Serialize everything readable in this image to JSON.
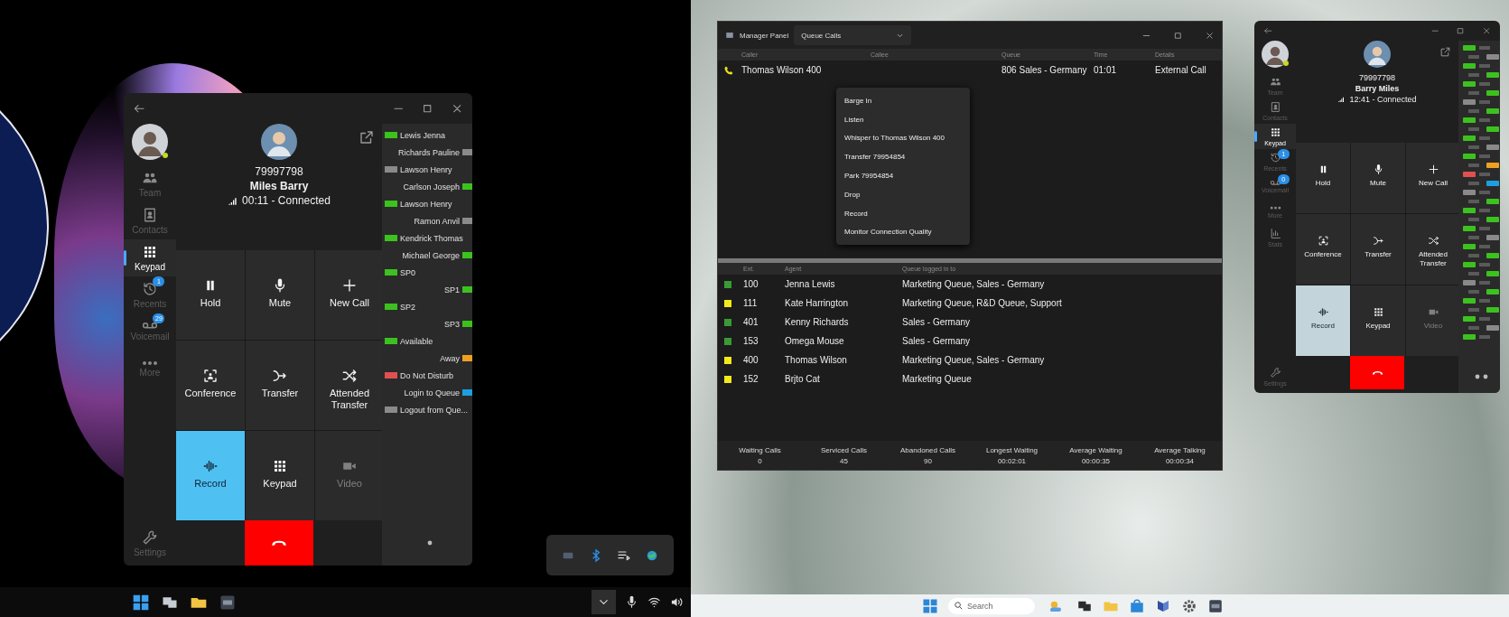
{
  "left_screen": {
    "phone": {
      "sidebar": [
        {
          "label": "Team",
          "selected": false
        },
        {
          "label": "Contacts",
          "selected": false
        },
        {
          "label": "Keypad",
          "selected": true
        },
        {
          "label": "Recents",
          "selected": false,
          "badge": "1"
        },
        {
          "label": "Voicemail",
          "selected": false,
          "badge": "29"
        },
        {
          "label": "More",
          "selected": false
        },
        {
          "label": "Settings",
          "selected": false
        }
      ],
      "caller": {
        "number": "79997798",
        "name": "Miles Barry",
        "status": "00:11 - Connected"
      },
      "actions": [
        {
          "label": "Hold",
          "on": false,
          "disabled": false
        },
        {
          "label": "Mute",
          "on": false,
          "disabled": false
        },
        {
          "label": "New Call",
          "on": false,
          "disabled": false
        },
        {
          "label": "Conference",
          "on": false,
          "disabled": false
        },
        {
          "label": "Transfer",
          "on": false,
          "disabled": false
        },
        {
          "label": "Attended Transfer",
          "on": false,
          "disabled": false
        },
        {
          "label": "Record",
          "on": true,
          "disabled": false
        },
        {
          "label": "Keypad",
          "on": false,
          "disabled": false
        },
        {
          "label": "Video",
          "on": false,
          "disabled": true
        }
      ],
      "presence": [
        {
          "label": "Lewis Jenna",
          "color": "#3cc21f"
        },
        {
          "label": "Richards Pauline",
          "color": "#8a8a8a"
        },
        {
          "label": "Lawson Henry",
          "color": "#8a8a8a"
        },
        {
          "label": "Carlson Joseph",
          "color": "#3cc21f"
        },
        {
          "label": "Lawson Henry",
          "color": "#3cc21f"
        },
        {
          "label": "Ramon Anvil",
          "color": "#8a8a8a"
        },
        {
          "label": "Kendrick Thomas",
          "color": "#3cc21f"
        },
        {
          "label": "Michael George",
          "color": "#3cc21f"
        },
        {
          "label": "SP0",
          "color": "#3cc21f"
        },
        {
          "label": "SP1",
          "color": "#3cc21f"
        },
        {
          "label": "SP2",
          "color": "#3cc21f"
        },
        {
          "label": "SP3",
          "color": "#3cc21f"
        },
        {
          "label": "Available",
          "color": "#3cc21f"
        },
        {
          "label": "Away",
          "color": "#f0a020"
        },
        {
          "label": "Do Not Disturb",
          "color": "#e05050"
        },
        {
          "label": "Login to Queue",
          "color": "#1e9ee0"
        },
        {
          "label": "Logout from Que...",
          "color": "#8a8a8a"
        }
      ]
    }
  },
  "right_screen": {
    "manager_panel": {
      "title": "Manager Panel",
      "view": "Queue Calls",
      "calls_table": {
        "columns": [
          "Caller",
          "Callee",
          "Queue",
          "Time",
          "Details"
        ],
        "rows": [
          {
            "caller": "Thomas Wilson 400",
            "queue": "806 Sales - Germany",
            "time": "01:01",
            "details": "External Call"
          }
        ]
      },
      "context_menu": [
        "Barge In",
        "Listen",
        "Whisper to Thomas Wilson 400",
        "Transfer 79954854",
        "Park 79954854",
        "Drop",
        "Record",
        "Monitor Connection Quality"
      ],
      "agents_table": {
        "columns": [
          "Ext.",
          "Agent",
          "Queue logged in to"
        ],
        "rows": [
          {
            "color": "#3a9a36",
            "ext": "100",
            "agent": "Jenna Lewis",
            "queues": "Marketing Queue, Sales - Germany"
          },
          {
            "color": "#f2ea1c",
            "ext": "111",
            "agent": "Kate Harrington",
            "queues": "Marketing Queue, R&D Queue, Support"
          },
          {
            "color": "#3a9a36",
            "ext": "401",
            "agent": "Kenny Richards",
            "queues": "Sales - Germany"
          },
          {
            "color": "#3a9a36",
            "ext": "153",
            "agent": "Omega Mouse",
            "queues": "Sales - Germany"
          },
          {
            "color": "#f2ea1c",
            "ext": "400",
            "agent": "Thomas Wilson",
            "queues": "Marketing Queue, Sales - Germany"
          },
          {
            "color": "#f2ea1c",
            "ext": "152",
            "agent": "Brjto Cat",
            "queues": "Marketing Queue"
          }
        ]
      },
      "stats": [
        {
          "label": "Waiting Calls",
          "value": "0"
        },
        {
          "label": "Serviced Calls",
          "value": "45"
        },
        {
          "label": "Abandoned Calls",
          "value": "90"
        },
        {
          "label": "Longest Waiting",
          "value": "00:02:01"
        },
        {
          "label": "Average Waiting",
          "value": "00:00:35"
        },
        {
          "label": "Average Talking",
          "value": "00:00:34"
        }
      ]
    },
    "phone": {
      "sidebar": [
        {
          "label": "Team",
          "selected": false
        },
        {
          "label": "Contacts",
          "selected": false
        },
        {
          "label": "Keypad",
          "selected": true
        },
        {
          "label": "Recents",
          "selected": false,
          "badge": "1"
        },
        {
          "label": "Voicemail",
          "selected": false,
          "badge": "0"
        },
        {
          "label": "More",
          "selected": false
        },
        {
          "label": "Stats",
          "selected": false
        },
        {
          "label": "Settings",
          "selected": false
        }
      ],
      "caller": {
        "number": "79997798",
        "name": "Barry Miles",
        "status": "12:41 - Connected"
      },
      "actions": [
        {
          "label": "Hold",
          "on": false,
          "disabled": false
        },
        {
          "label": "Mute",
          "on": false,
          "disabled": false
        },
        {
          "label": "New Call",
          "on": false,
          "disabled": false
        },
        {
          "label": "Conference",
          "on": false,
          "disabled": false
        },
        {
          "label": "Transfer",
          "on": false,
          "disabled": false
        },
        {
          "label": "Attended Transfer",
          "on": false,
          "disabled": false
        },
        {
          "label": "Record",
          "on": true,
          "disabled": false
        },
        {
          "label": "Keypad",
          "on": false,
          "disabled": false
        },
        {
          "label": "Video",
          "on": false,
          "disabled": true
        }
      ]
    },
    "taskbar": {
      "search_placeholder": "Search"
    }
  }
}
